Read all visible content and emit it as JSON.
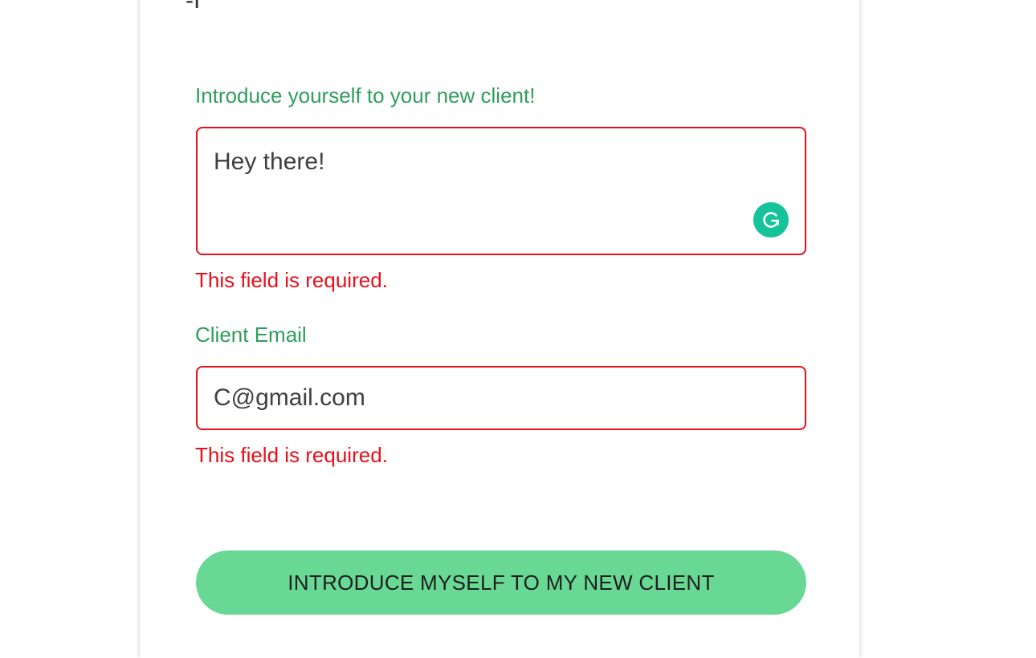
{
  "header": {
    "clipped_text": "-I"
  },
  "intro": {
    "label": "Introduce yourself to your new client!",
    "value": "Hey there!",
    "error": "This field is required.",
    "extension_icon": "grammarly-icon"
  },
  "email": {
    "label": "Client Email",
    "value": "C@gmail.com",
    "error": "This field is required."
  },
  "submit": {
    "label": "INTRODUCE MYSELF TO MY NEW CLIENT"
  },
  "colors": {
    "label_green": "#2e9e5b",
    "error_red": "#e8101a",
    "button_green": "#68d894",
    "grammarly_green": "#15c39a"
  }
}
